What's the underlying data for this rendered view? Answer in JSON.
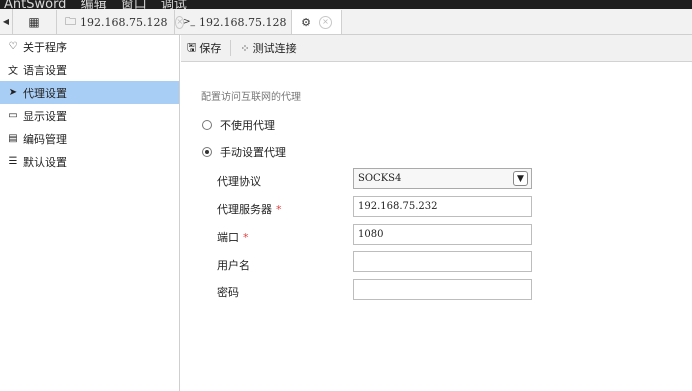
{
  "menu": {
    "items": [
      "AntSword",
      "编辑",
      "窗口",
      "调试"
    ]
  },
  "tabs": [
    {
      "icon": "grid-icon",
      "label": ""
    },
    {
      "icon": "folder-icon",
      "label": "192.168.75.128"
    },
    {
      "icon": "terminal-icon",
      "label": "192.168.75.128"
    },
    {
      "icon": "gear-icon",
      "label": ""
    }
  ],
  "sidebar": {
    "items": [
      {
        "icon": "heart-icon",
        "label": "关于程序"
      },
      {
        "icon": "language-icon",
        "label": "语言设置"
      },
      {
        "icon": "paper-plane-icon",
        "label": "代理设置"
      },
      {
        "icon": "monitor-icon",
        "label": "显示设置"
      },
      {
        "icon": "file-code-icon",
        "label": "编码管理"
      },
      {
        "icon": "sliders-icon",
        "label": "默认设置"
      }
    ],
    "selected_index": 2
  },
  "toolbar": {
    "save_label": "保存",
    "test_label": "测试连接"
  },
  "form": {
    "section_title": "配置访问互联网的代理",
    "option_no_proxy": "不使用代理",
    "option_manual": "手动设置代理",
    "selected_option": "manual",
    "fields": {
      "protocol": {
        "label": "代理协议",
        "value": "SOCKS4",
        "required": false
      },
      "server": {
        "label": "代理服务器",
        "value": "192.168.75.232",
        "required": true
      },
      "port": {
        "label": "端口",
        "value": "1080",
        "required": true
      },
      "username": {
        "label": "用户名",
        "value": "",
        "required": false
      },
      "password": {
        "label": "密码",
        "value": "",
        "required": false
      }
    },
    "required_mark": "*"
  },
  "colors": {
    "selected_bg": "#a9cef6",
    "required": "#e04040"
  }
}
